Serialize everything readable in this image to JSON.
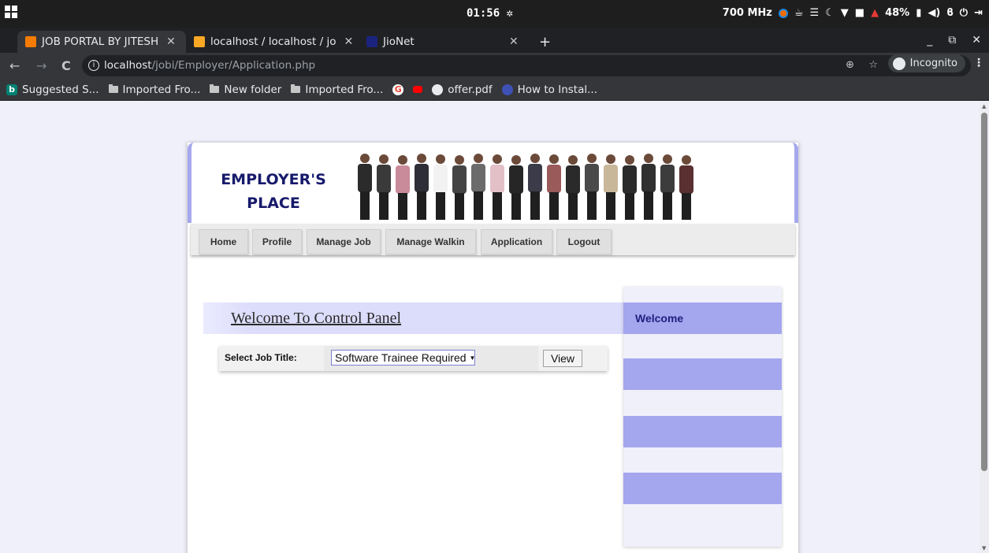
{
  "os": {
    "time": "01:56",
    "cpu": "700 MHz",
    "battery": "48%"
  },
  "tabs": [
    {
      "title": "JOB PORTAL BY JITESH",
      "active": true,
      "favicon_color": "#f57c00"
    },
    {
      "title": "localhost / localhost / jo",
      "active": false,
      "favicon_color": "#f9a825"
    },
    {
      "title": "JioNet",
      "active": false,
      "favicon_color": "#1a237e"
    }
  ],
  "addressbar": {
    "host": "localhost",
    "path": "/jobi/Employer/Application.php",
    "incognito_label": "Incognito"
  },
  "bookmarks": [
    {
      "label": "Suggested S...",
      "icon": "bing-icon"
    },
    {
      "label": "Imported Fro...",
      "icon": "folder-icon"
    },
    {
      "label": "New folder",
      "icon": "folder-icon"
    },
    {
      "label": "Imported Fro...",
      "icon": "folder-icon"
    },
    {
      "label": "",
      "icon": "google-icon"
    },
    {
      "label": "",
      "icon": "youtube-icon"
    },
    {
      "label": "offer.pdf",
      "icon": "globe-icon"
    },
    {
      "label": "How to Instal...",
      "icon": "blue-dot-icon"
    }
  ],
  "banner": {
    "line1": "EMPLOYER'S",
    "line2": "PLACE"
  },
  "menu": [
    "Home",
    "Profile",
    "Manage Job",
    "Manage Walkin",
    "Application",
    "Logout"
  ],
  "main": {
    "heading": "Welcome To Control Panel",
    "select_label": "Select Job Title:",
    "selected_job": "Software Trainee Required",
    "view_button": "View"
  },
  "sidebar": {
    "welcome_label": "Welcome"
  },
  "colors": {
    "accent": "#a4a6ee",
    "banner_title": "#171a6b"
  }
}
